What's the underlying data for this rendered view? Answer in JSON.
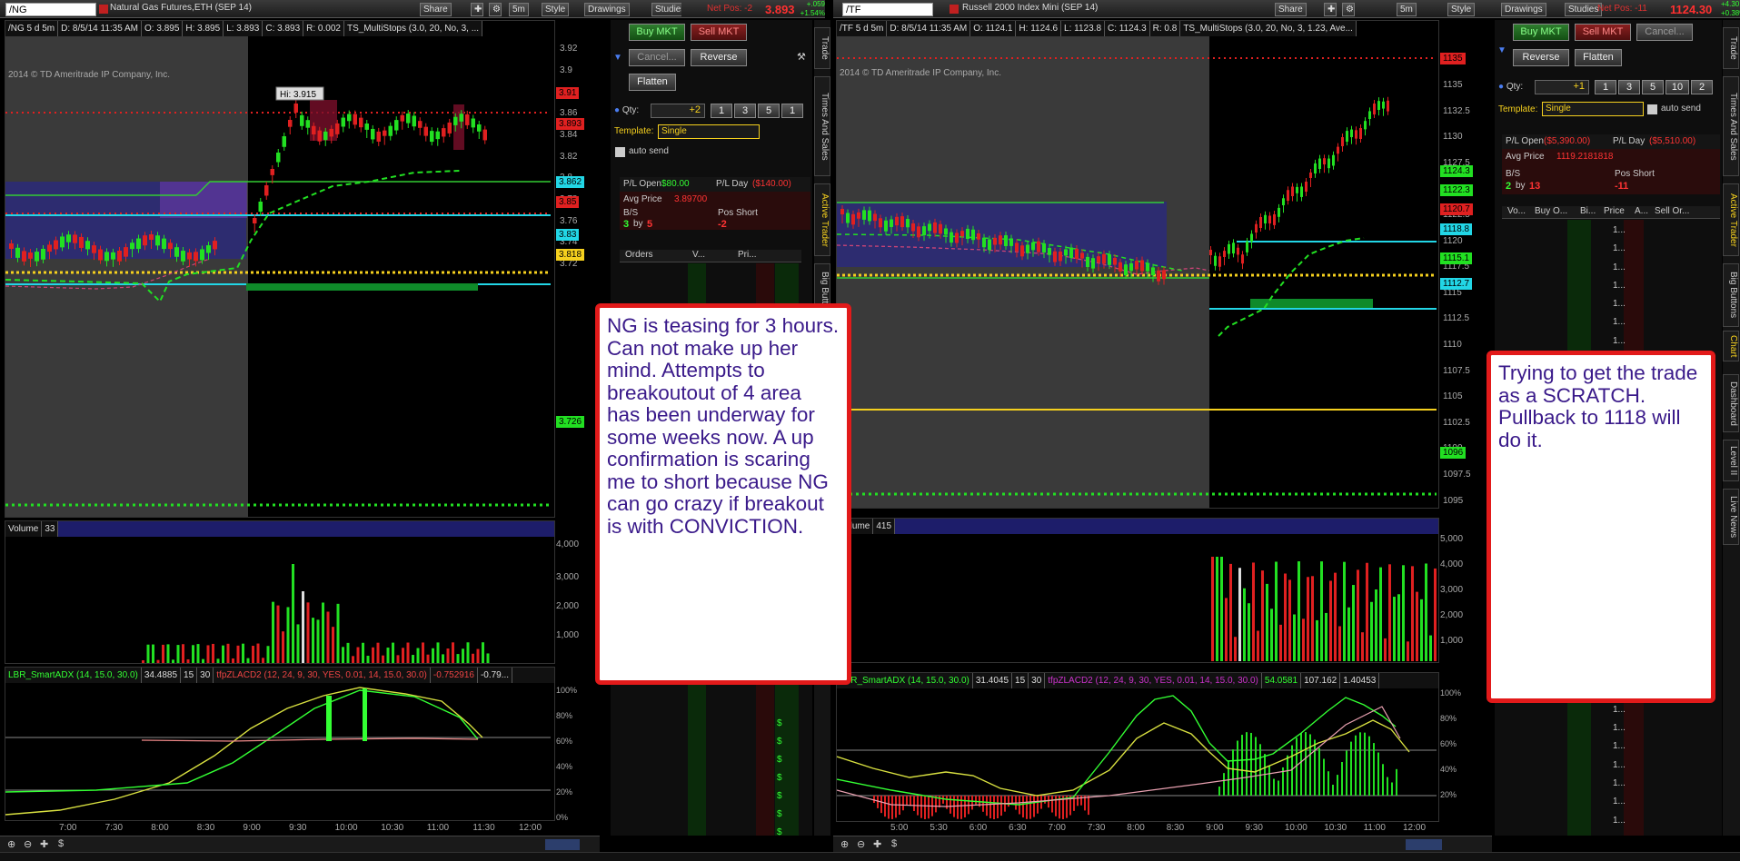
{
  "left": {
    "symbol": "/NG",
    "desc": "Natural Gas Futures,ETH (SEP 14)",
    "toolbar": {
      "share": "Share",
      "period": "5m",
      "style": "Style",
      "drawings": "Drawings",
      "studies": "Studies"
    },
    "netpos_label": "Net Pos: -2",
    "last_price": "3.893",
    "change_up": "+.059",
    "change_pct": "+1.54%",
    "chart_header": [
      "/NG 5 d 5m",
      "D: 8/5/14 11:35 AM",
      "O: 3.895",
      "H: 3.895",
      "L: 3.893",
      "C: 3.893",
      "R: 0.002",
      "TS_MultiStops (3.0, 20, No, 3, ..."
    ],
    "copyright": "2014 © TD Ameritrade IP Company, Inc.",
    "hi_label": "Hi: 3.915",
    "price_ticks": [
      "3.92",
      "3.9",
      "3.88",
      "3.86",
      "3.84",
      "3.82",
      "3.8",
      "3.78",
      "3.76",
      "3.74",
      "3.72"
    ],
    "price_badges": [
      {
        "text": "3.91",
        "color": "#e02020"
      },
      {
        "text": "3.893",
        "color": "#e02020"
      },
      {
        "text": "3.862",
        "color": "#22d6e6"
      },
      {
        "text": "3.85",
        "color": "#e02020"
      },
      {
        "text": "3.83",
        "color": "#22d6e6"
      },
      {
        "text": "3.818",
        "color": "#f5d01e"
      },
      {
        "text": "3.726",
        "color": "#22e022"
      }
    ],
    "volume_label": "Volume",
    "volume_value": "33",
    "volume_ticks": [
      "4,000",
      "3,000",
      "2,000",
      "1,000"
    ],
    "study_header": [
      "LBR_SmartADX (14, 15.0, 30.0)",
      "34.4885",
      "15",
      "30",
      "tfpZLACD2 (12, 24, 9, 30, YES, 0.01, 14, 15.0, 30.0)",
      "-0.752916",
      "-0.79..."
    ],
    "study_ticks": [
      "100%",
      "80%",
      "60%",
      "40%",
      "20%",
      "0%"
    ],
    "time_ticks": [
      "7:00",
      "7:30",
      "8:00",
      "8:30",
      "9:00",
      "9:30",
      "10:00",
      "10:30",
      "11:00",
      "11:30",
      "12:00"
    ]
  },
  "left_trader": {
    "buy": "Buy MKT",
    "sell": "Sell MKT",
    "cancel": "Cancel...",
    "reverse": "Reverse",
    "flatten": "Flatten",
    "qty_label": "Qty:",
    "qty_value": "+2",
    "qty_opts": [
      "1",
      "3",
      "5",
      "1"
    ],
    "template_label": "Template:",
    "template_value": "Single",
    "autosend": "auto send",
    "pl_open_label": "P/L Open",
    "pl_open": "$80.00",
    "pl_day_label": "P/L Day",
    "pl_day": "($140.00)",
    "avg_label": "Avg Price",
    "avg_value": "3.89700",
    "bs_label": "B/S",
    "bs_buy": "3",
    "bs_by": "by",
    "bs_sell": "5",
    "pos_label": "Pos Short",
    "pos_value": "-2",
    "cols": [
      "Orders",
      "V...",
      "Pri..."
    ],
    "dollar": "$"
  },
  "right": {
    "symbol": "/TF",
    "desc": "Russell 2000 Index Mini (SEP 14)",
    "toolbar": {
      "share": "Share",
      "period": "5m",
      "style": "Style",
      "drawings": "Drawings",
      "studies": "Studies"
    },
    "netpos_label": "Net Pos: -11",
    "last_price": "1124.30",
    "change_up": "+4.30",
    "change_pct": "+0.38%",
    "chart_header": [
      "/TF 5 d 5m",
      "D: 8/5/14 11:35 AM",
      "O: 1124.1",
      "H: 1124.6",
      "L: 1123.8",
      "C: 1124.3",
      "R: 0.8",
      "TS_MultiStops (3.0, 20, No, 3, 1.23, Ave..."
    ],
    "copyright": "2014 © TD Ameritrade IP Company, Inc.",
    "price_ticks": [
      "1135",
      "1132.5",
      "1130",
      "1127.5",
      "1125",
      "1122.5",
      "1120",
      "1117.5",
      "1115",
      "1112.5",
      "1110",
      "1107.5",
      "1105",
      "1102.5",
      "1100",
      "1097.5",
      "1095"
    ],
    "price_badges": [
      {
        "text": "1135",
        "color": "#e02020"
      },
      {
        "text": "1124.3",
        "color": "#22e022"
      },
      {
        "text": "1122.3",
        "color": "#22e022"
      },
      {
        "text": "1120.7",
        "color": "#e02020"
      },
      {
        "text": "1118.8",
        "color": "#22d6e6"
      },
      {
        "text": "1115.1",
        "color": "#22e022"
      },
      {
        "text": "1112.7",
        "color": "#22d6e6"
      },
      {
        "text": "1096",
        "color": "#22e022"
      }
    ],
    "volume_label": "Volume",
    "volume_value": "415",
    "volume_ticks": [
      "5,000",
      "4,000",
      "3,000",
      "2,000",
      "1,000"
    ],
    "study_header": [
      "LBR_SmartADX (14, 15.0, 30.0)",
      "31.4045",
      "15",
      "30",
      "tfpZLACD2 (12, 24, 9, 30, YES, 0.01, 14, 15.0, 30.0)",
      "54.0581",
      "107.162",
      "1.40453"
    ],
    "study_ticks": [
      "100%",
      "80%",
      "60%",
      "40%",
      "20%"
    ],
    "time_ticks": [
      "5:00",
      "5:30",
      "6:00",
      "6:30",
      "7:00",
      "7:30",
      "8:00",
      "8:30",
      "9:00",
      "9:30",
      "10:00",
      "10:30",
      "11:00",
      "12:00"
    ]
  },
  "right_trader": {
    "buy": "Buy MKT",
    "sell": "Sell MKT",
    "cancel": "Cancel...",
    "reverse": "Reverse",
    "flatten": "Flatten",
    "qty_label": "Qty:",
    "qty_value": "+1",
    "qty_opts": [
      "1",
      "3",
      "5",
      "10",
      "2"
    ],
    "template_label": "Template:",
    "template_value": "Single",
    "autosend": "auto send",
    "pl_open_label": "P/L Open",
    "pl_open": "($5,390.00)",
    "pl_day_label": "P/L Day",
    "pl_day": "($5,510.00)",
    "avg_label": "Avg Price",
    "avg_value": "1119.2181818",
    "bs_label": "B/S",
    "bs_buy": "2",
    "bs_by": "by",
    "bs_sell": "13",
    "pos_label": "Pos Short",
    "pos_value": "-11",
    "cols": [
      "Vo...",
      "Buy O...",
      "Bi...",
      "Price",
      "A...",
      "Sell Or..."
    ],
    "ladder_price": "1..."
  },
  "side_tabs_left": [
    "Trade",
    "Times And Sales",
    "Active Trader",
    "Big Buttons"
  ],
  "side_tabs_right": [
    "Trade",
    "Times And Sales",
    "Active Trader",
    "Big Buttons",
    "Chart",
    "Dashboard",
    "Level II",
    "Live News"
  ],
  "notes": {
    "ng": "NG is teasing for 3 hours. Can not make up her mind. Attempts to breakoutout of 4 area has been underway for some weeks now. A up confirmation is scaring me to short because NG can go crazy if breakout is with CONVICTION.",
    "tf": "Trying to get the trade as a SCRATCH. Pullback to 1118 will do it."
  }
}
